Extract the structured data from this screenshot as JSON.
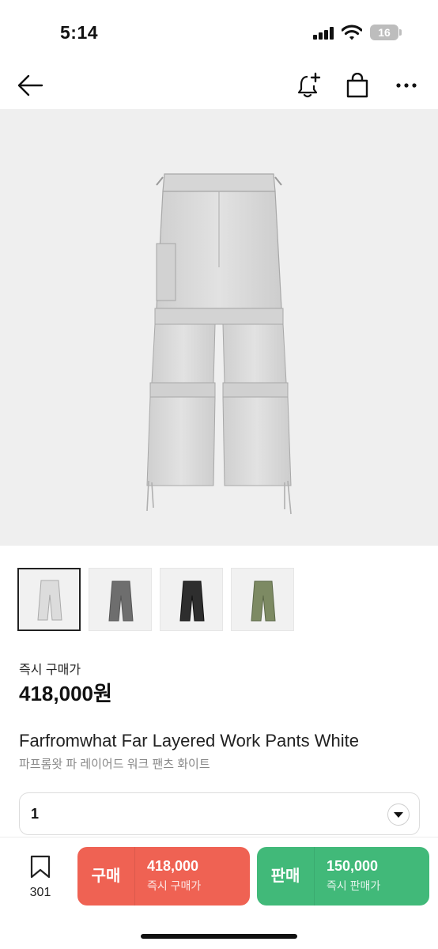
{
  "status_bar": {
    "time": "5:14",
    "battery_level": "16"
  },
  "nav": {
    "back_icon": "arrow-left-icon",
    "alert_icon": "bell-plus-icon",
    "bag_icon": "shopping-bag-icon",
    "more_icon": "more-horizontal-icon"
  },
  "product": {
    "thumbnail_colors": [
      "#e3e3e3",
      "#6e6e6e",
      "#2e2e2e",
      "#7d8a63"
    ],
    "price_label": "즉시 구매가",
    "price": "418,000원",
    "name_en": "Farfromwhat Far Layered Work Pants White",
    "name_ko": "파프롬왓 파 레이어드 워크 팬츠 화이트"
  },
  "size_select": {
    "selected": "1"
  },
  "bottom_bar": {
    "wish_count": "301",
    "buy": {
      "label": "구매",
      "price": "418,000",
      "sub": "즉시 구매가",
      "color": "#ef6253"
    },
    "sell": {
      "label": "판매",
      "price": "150,000",
      "sub": "즉시 판매가",
      "color": "#41b979"
    }
  }
}
